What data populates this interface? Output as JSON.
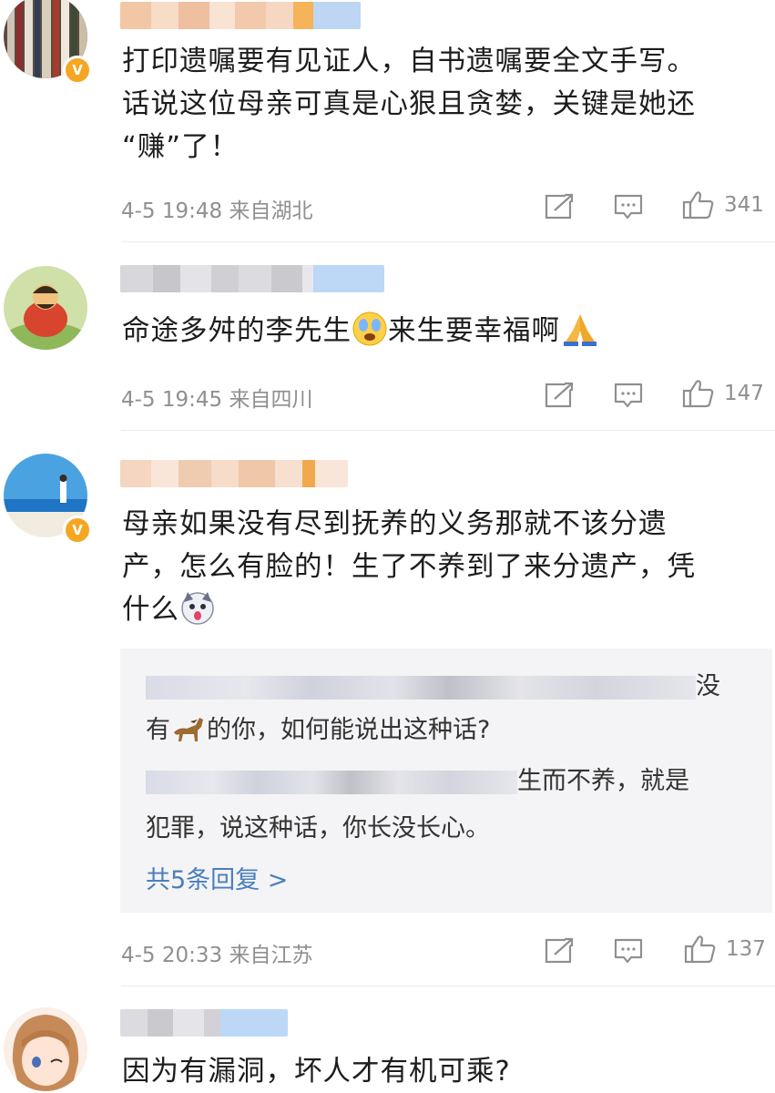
{
  "comments": [
    {
      "text_lines": [
        "打印遗嘱要有见证人，自书遗嘱要全文手写。",
        "话说这位母亲可真是心狠且贪婪，关键是她还",
        "“赚”了！"
      ],
      "time": "4-5 19:48",
      "location": "来自湖北",
      "likes": "341",
      "verified": true,
      "avatar_icon": "bookshelf-avatar"
    },
    {
      "text_pre": "命途多舛的李先生",
      "text_mid": "来生要幸福啊",
      "emoji_1": "crying-face-icon",
      "emoji_2": "praying-hands-icon",
      "time": "4-5 19:45",
      "location": "来自四川",
      "likes": "147",
      "verified": false,
      "avatar_icon": "cartoon-man-avatar"
    },
    {
      "text_lines": [
        "母亲如果没有尽到抚养的义务那就不该分遗",
        "产，怎么有脸的！生了不养到了来分遗产，凭",
        "什么"
      ],
      "emoji": "husky-icon",
      "time": "4-5 20:33",
      "location": "来自江苏",
      "likes": "137",
      "verified": true,
      "avatar_icon": "beach-avatar",
      "replies": {
        "reply1_tail": "没",
        "reply1_line2_pre": "有",
        "reply1_line2_post": "的你，如何能说出这种话?",
        "reply1_emoji": "horse-icon",
        "reply2_tail": "生而不养，就是",
        "reply2_line2": "犯罪，说这种话，你长没长心。",
        "more_label": "共5条回复 >"
      }
    },
    {
      "text": "因为有漏洞，坏人才有机可乘?",
      "verified": false,
      "avatar_icon": "anime-girl-avatar"
    }
  ],
  "colors": {
    "meta": "#8f8f8f",
    "link": "#4a7fbd",
    "badge": "#f5a623",
    "reply_bg": "#f4f4f6"
  }
}
